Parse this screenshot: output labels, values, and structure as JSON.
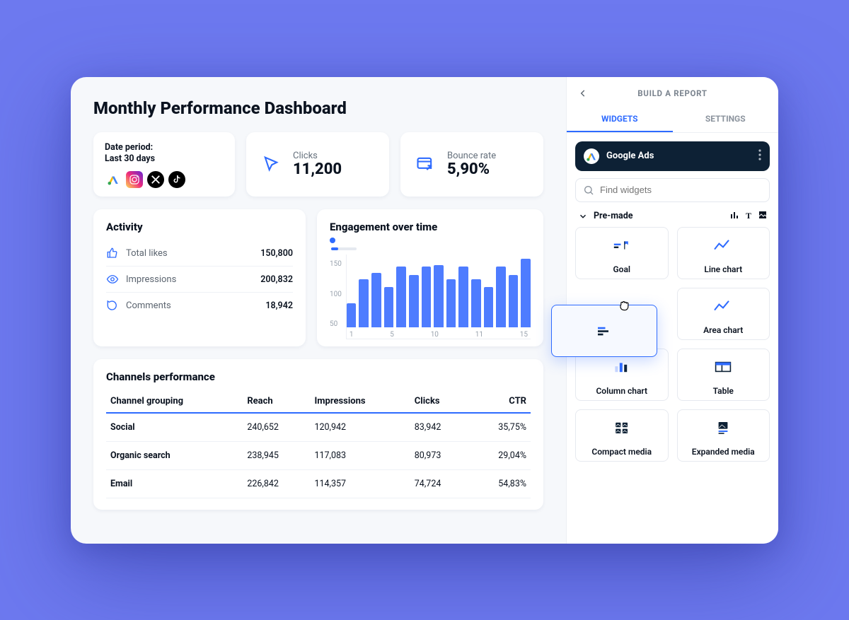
{
  "title": "Monthly Performance Dashboard",
  "date": {
    "label1": "Date period:",
    "label2": "Last 30 days"
  },
  "kpi": {
    "clicks": {
      "label": "Clicks",
      "value": "11,200"
    },
    "bounce": {
      "label": "Bounce rate",
      "value": "5,90%"
    }
  },
  "activity": {
    "title": "Activity",
    "rows": [
      {
        "label": "Total likes",
        "value": "150,800"
      },
      {
        "label": "Impressions",
        "value": "200,832"
      },
      {
        "label": "Comments",
        "value": "18,942"
      }
    ]
  },
  "engagement": {
    "title": "Engagement over time",
    "yticks": [
      "150",
      "100",
      "50"
    ],
    "xticks": [
      "1",
      "5",
      "10",
      "11",
      "15"
    ]
  },
  "channels": {
    "title": "Channels performance",
    "headers": [
      "Channel grouping",
      "Reach",
      "Impressions",
      "Clicks",
      "CTR"
    ],
    "rows": [
      [
        "Social",
        "240,652",
        "120,942",
        "83,942",
        "35,75%"
      ],
      [
        "Organic search",
        "238,945",
        "117,083",
        "80,973",
        "29,04%"
      ],
      [
        "Email",
        "226,842",
        "114,357",
        "74,724",
        "54,83%"
      ]
    ]
  },
  "side": {
    "title": "BUILD A REPORT",
    "tabs": {
      "widgets": "WIDGETS",
      "settings": "SETTINGS"
    },
    "source": "Google Ads",
    "search_placeholder": "Find widgets",
    "section": "Pre-made",
    "widgets": [
      "Goal",
      "Line chart",
      "",
      "Area chart",
      "Column chart",
      "Table",
      "Compact media",
      "Expanded media"
    ]
  },
  "chart_data": {
    "type": "bar",
    "title": "Engagement over time",
    "ylim": [
      0,
      180
    ],
    "yticks": [
      50,
      100,
      150
    ],
    "x": [
      1,
      2,
      3,
      4,
      5,
      6,
      7,
      8,
      9,
      10,
      11,
      12,
      13,
      14,
      15
    ],
    "values": [
      60,
      120,
      135,
      100,
      150,
      130,
      150,
      155,
      120,
      150,
      120,
      100,
      150,
      130,
      170
    ]
  }
}
